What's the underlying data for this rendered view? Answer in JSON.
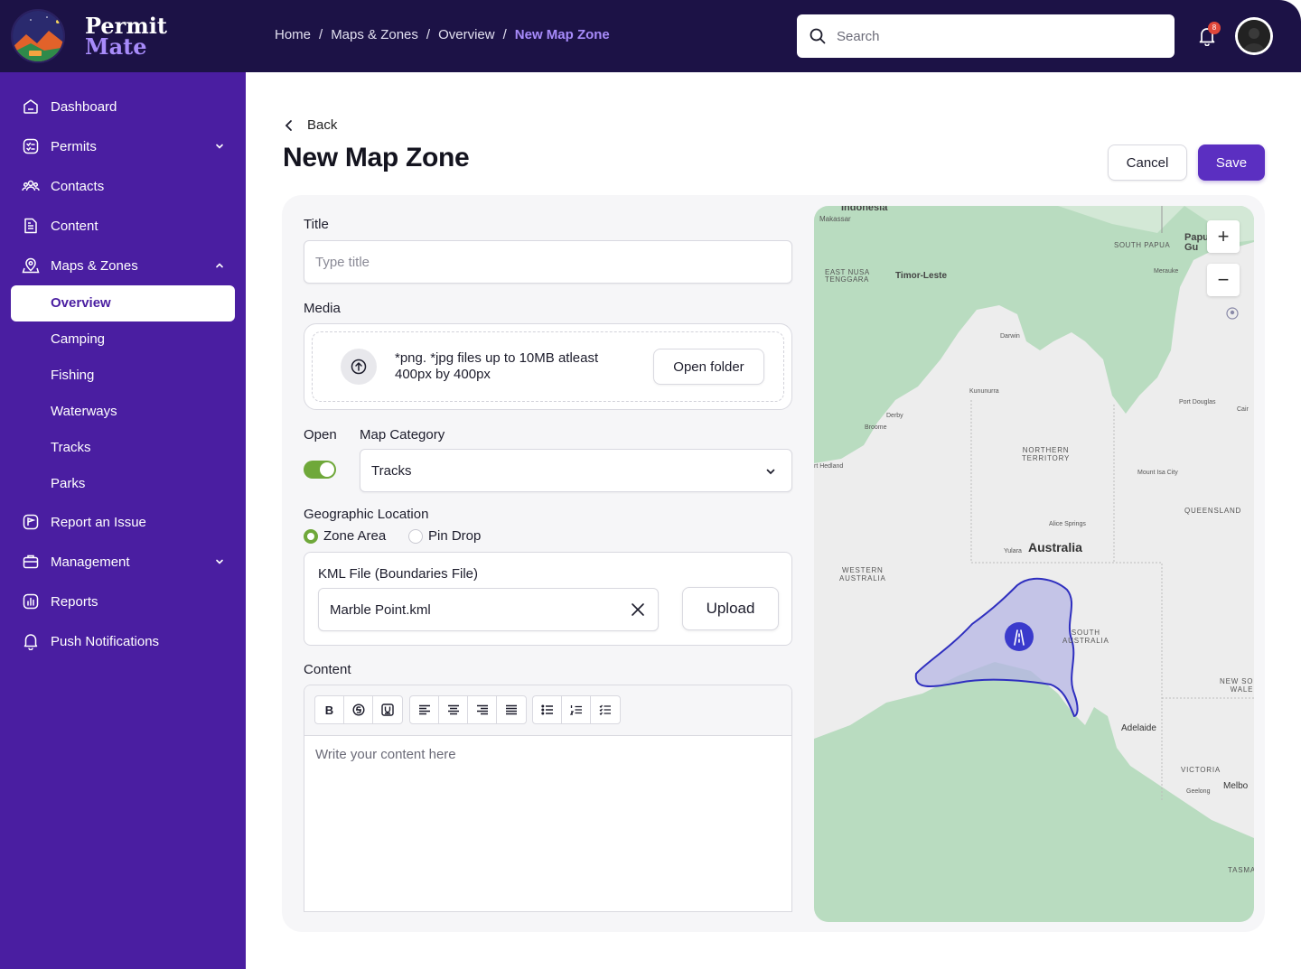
{
  "brand": {
    "line1": "Permit",
    "line2": "Mate"
  },
  "breadcrumb": [
    "Home",
    "Maps & Zones",
    "Overview",
    "New Map Zone"
  ],
  "search": {
    "placeholder": "Search"
  },
  "notifications": {
    "count": "8"
  },
  "sidebar": {
    "items": [
      {
        "label": "Dashboard",
        "icon": "home-icon"
      },
      {
        "label": "Permits",
        "icon": "checklist-icon",
        "expanded": false
      },
      {
        "label": "Contacts",
        "icon": "people-icon"
      },
      {
        "label": "Content",
        "icon": "document-icon"
      },
      {
        "label": "Maps & Zones",
        "icon": "map-pin-icon",
        "expanded": true
      },
      {
        "label": "Report an Issue",
        "icon": "report-icon"
      },
      {
        "label": "Management",
        "icon": "briefcase-icon",
        "expanded": false
      },
      {
        "label": "Reports",
        "icon": "chart-icon"
      },
      {
        "label": "Push Notifications",
        "icon": "bell-icon"
      }
    ],
    "sub_items": [
      "Overview",
      "Camping",
      "Fishing",
      "Waterways",
      "Tracks",
      "Parks"
    ],
    "active_sub": "Overview"
  },
  "page": {
    "back_label": "Back",
    "title": "New Map Zone",
    "cancel_label": "Cancel",
    "save_label": "Save"
  },
  "form": {
    "title_label": "Title",
    "title_placeholder": "Type title",
    "media_label": "Media",
    "media_hint": "*png. *jpg files up to 10MB atleast 400px by 400px",
    "open_folder_label": "Open folder",
    "open_label": "Open",
    "open_value": true,
    "category_label": "Map Category",
    "category_value": "Tracks",
    "geo_label": "Geographic Location",
    "geo_options": [
      "Zone Area",
      "Pin Drop"
    ],
    "geo_selected": "Zone Area",
    "kml_label": "KML File (Boundaries File)",
    "kml_value": "Marble Point.kml",
    "upload_label": "Upload",
    "content_label": "Content",
    "content_placeholder": "Write your content here",
    "toolbar_bold": "B"
  },
  "map": {
    "labels": {
      "indonesia": "Indonesia",
      "makassar": "Makassar",
      "south_papua": "SOUTH PAPUA",
      "papua_gu": "Papu Gu",
      "merauke": "Merauke",
      "east_nusa": "EAST NUSA",
      "tenggara": "TENGGARA",
      "timor": "Timor-Leste",
      "darwin": "Darwin",
      "kununurra": "Kununurra",
      "derby": "Derby",
      "broome": "Broome",
      "port_douglas": "Port Douglas",
      "cairns": "Cair",
      "port_hedland": "rt Hedland",
      "nt1": "NORTHERN",
      "nt2": "TERRITORY",
      "mount_isa": "Mount Isa City",
      "queensland": "QUEENSLAND",
      "alice": "Alice Springs",
      "yulara": "Yulara",
      "australia": "Australia",
      "wa1": "WESTERN",
      "wa2": "AUSTRALIA",
      "sa1": "SOUTH",
      "sa2": "AUSTRALIA",
      "nsw1": "NEW SO",
      "nsw2": "WALE",
      "adelaide": "Adelaide",
      "victoria": "VICTORIA",
      "geelong": "Geelong",
      "melbourne": "Melbo",
      "tasmania": "TASMA"
    },
    "zoom_in": "+",
    "zoom_out": "−"
  },
  "colors": {
    "header_bg": "#1c1246",
    "sidebar_bg": "#4a1ea1",
    "accent": "#5b2fc1",
    "toggle_on": "#6fa83a",
    "breadcrumb_current": "#a78bfa"
  }
}
